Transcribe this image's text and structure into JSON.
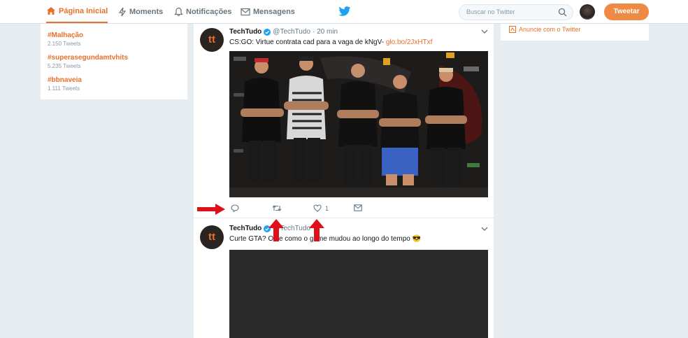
{
  "nav": {
    "home": "Página Inicial",
    "moments": "Moments",
    "notifications": "Notificações",
    "messages": "Mensagens"
  },
  "search": {
    "placeholder": "Buscar no Twitter"
  },
  "tweet_button": "Tweetar",
  "trends": [
    {
      "name": "#Malhação",
      "count": "2.150 Tweets"
    },
    {
      "name": "#superasegundamtvhits",
      "count": "5.235 Tweets"
    },
    {
      "name": "#bbnaveia",
      "count": "1.111 Tweets"
    }
  ],
  "ad_link": "Anuncie com o Twitter",
  "tweets": [
    {
      "avatar_text": "tt",
      "name": "TechTudo",
      "handle": "@TechTudo",
      "time": "· 20 min",
      "text": "CS:GO: Virtue contrata cad para a vaga de kNgV-",
      "link": "glo.bo/2JxHTxf",
      "like_count": "1"
    },
    {
      "avatar_text": "tt",
      "name": "TechTudo",
      "handle": "@TechTudo",
      "time": "",
      "text": "Curte GTA? Olhe como o game mudou ao longo do tempo",
      "emoji": "😎"
    }
  ],
  "colors": {
    "accent": "#e8702a",
    "tweet_button": "#ef8a44",
    "annotation_arrow": "#e0101a",
    "background": "#e6ecf0"
  }
}
